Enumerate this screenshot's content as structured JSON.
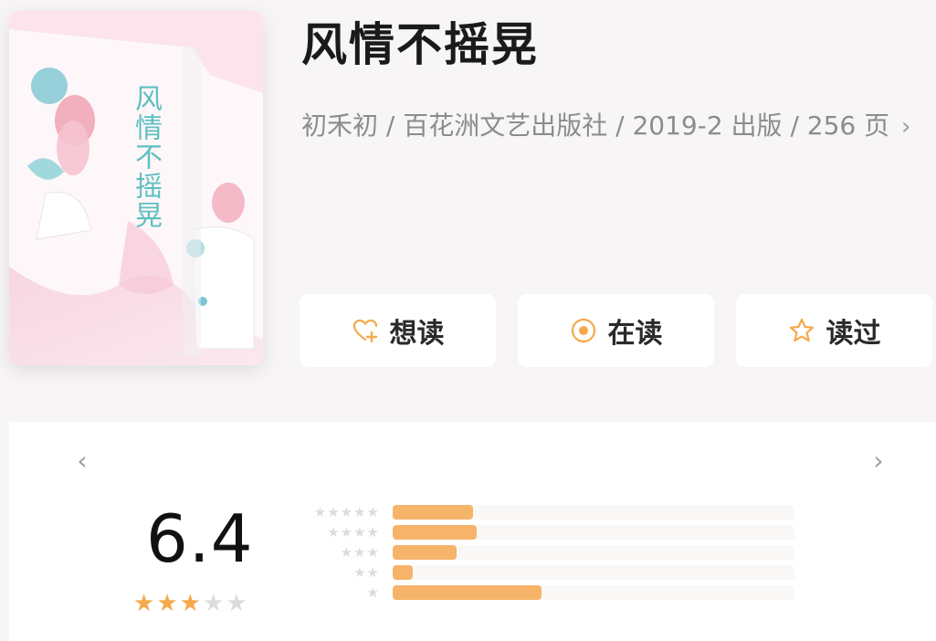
{
  "book": {
    "title": "风情不摇晃",
    "meta": "初禾初 / 百花洲文艺出版社 / 2019-2 出版 / 256 页",
    "meta_chevron": "›",
    "cover_title": "风情不摇晃"
  },
  "actions": [
    {
      "label": "想读",
      "icon": "heart-plus-icon"
    },
    {
      "label": "在读",
      "icon": "radio-dot-icon"
    },
    {
      "label": "读过",
      "icon": "star-outline-icon"
    }
  ],
  "rating": {
    "prev_arrow": "‹",
    "next_arrow": "›",
    "score": "6.4",
    "stars_filled": 3,
    "stars_total": 5,
    "distribution": [
      {
        "stars": "★★★★★",
        "fraction": 0.2
      },
      {
        "stars": "★★★★",
        "fraction": 0.21
      },
      {
        "stars": "★★★",
        "fraction": 0.16
      },
      {
        "stars": "★★",
        "fraction": 0.05
      },
      {
        "stars": "★",
        "fraction": 0.37
      }
    ]
  },
  "colors": {
    "accent": "#f5a94b",
    "bar": "#f6b46b",
    "star_off": "#dcdcdc",
    "meta_text": "#8c8c8c"
  }
}
